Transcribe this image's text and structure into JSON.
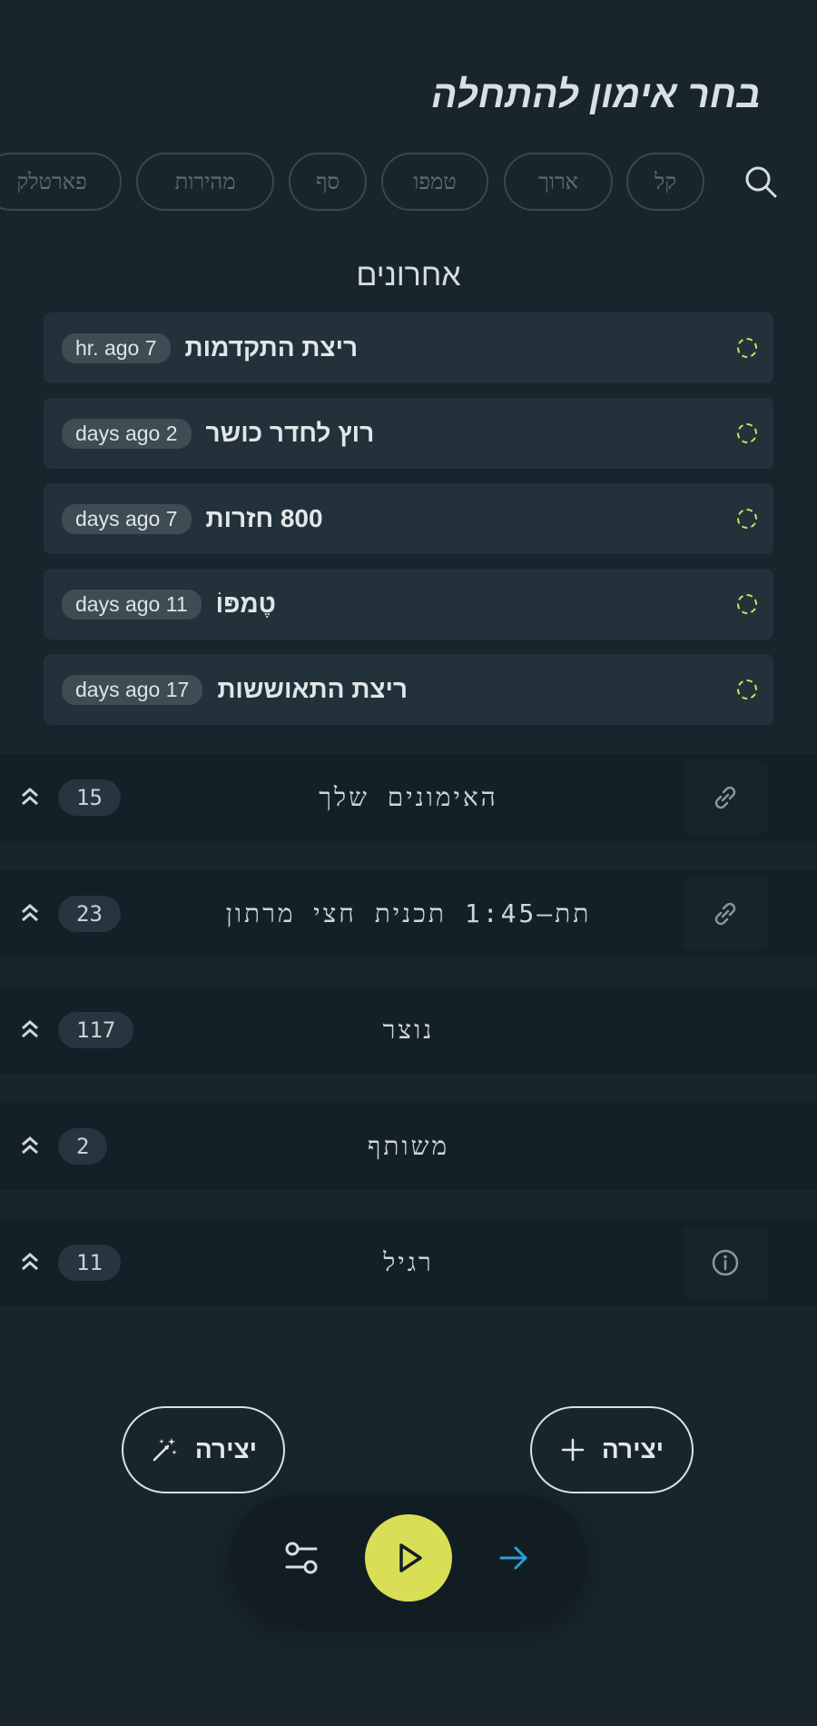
{
  "header": {
    "title": "בחר אימון להתחלה"
  },
  "filters": {
    "search_icon": "search-icon",
    "chips": [
      "קל",
      "ארוך",
      "טמפו",
      "סף",
      "מהירות",
      "פארטלק"
    ]
  },
  "recents": {
    "heading": "אחרונים",
    "items": [
      {
        "title": "ריצת התקדמות",
        "time": "hr. ago 7"
      },
      {
        "title": "רוץ לחדר כושר",
        "time": "days ago 2"
      },
      {
        "title": "800 חזרות",
        "time": "days ago 7"
      },
      {
        "title": "טֶמפּוֹ",
        "time": "days ago 11"
      },
      {
        "title": "ריצת התאוששות",
        "time": "days ago 17"
      }
    ]
  },
  "sections": [
    {
      "label": "האימונים שלך",
      "count": "15",
      "action_icon": "link-icon"
    },
    {
      "label": "תת–1:45 תכנית חצי מרתון",
      "count": "23",
      "action_icon": "link-icon"
    },
    {
      "label": "נוצר",
      "count": "117",
      "action_icon": ""
    },
    {
      "label": "משותף",
      "count": "2",
      "action_icon": ""
    },
    {
      "label": "רגיל",
      "count": "11",
      "action_icon": "info-icon"
    }
  ],
  "actions": {
    "create_ai_label": "יצירה",
    "create_label": "יצירה"
  },
  "bottom_bar": {
    "settings_icon": "sliders-icon",
    "play_icon": "play-icon",
    "arrow_icon": "arrow-right-icon"
  },
  "colors": {
    "background": "#18252d",
    "accent": "#d8df57",
    "arrow": "#2b9fd8"
  }
}
